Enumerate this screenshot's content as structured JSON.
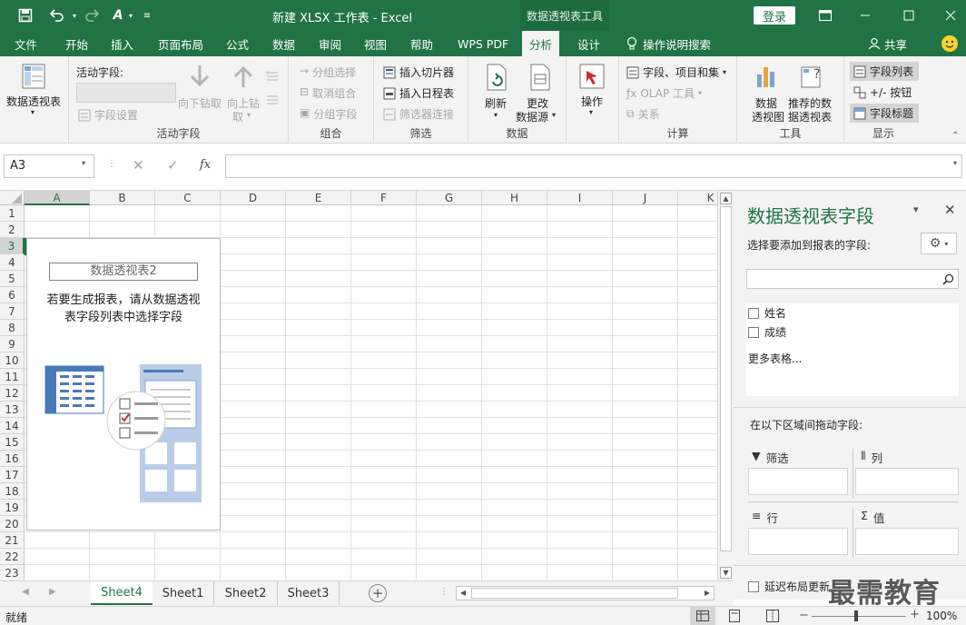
{
  "titlebar": {
    "title": "新建 XLSX 工作表  -  Excel",
    "context_tool": "数据透视表工具",
    "login": "登录"
  },
  "tabs": [
    {
      "label": "文件"
    },
    {
      "label": "开始"
    },
    {
      "label": "插入"
    },
    {
      "label": "页面布局"
    },
    {
      "label": "公式"
    },
    {
      "label": "数据"
    },
    {
      "label": "审阅"
    },
    {
      "label": "视图"
    },
    {
      "label": "帮助"
    },
    {
      "label": "WPS PDF"
    },
    {
      "label": "分析"
    },
    {
      "label": "设计"
    }
  ],
  "tell_me": "操作说明搜索",
  "share": "共享",
  "ribbon": {
    "pivot": {
      "label": "数据透视表"
    },
    "active_field": {
      "title": "活动字段:",
      "field_settings": "字段设置",
      "drill_down": "向下钻取",
      "drill_up": "向上钻",
      "drill_up2": "取",
      "group_label": "活动字段"
    },
    "group": {
      "group_select": "分组选择",
      "ungroup": "取消组合",
      "group_field": "分组字段",
      "group_label": "组合"
    },
    "filter": {
      "slicer": "插入切片器",
      "timeline": "插入日程表",
      "connections": "筛选器连接",
      "group_label": "筛选"
    },
    "data": {
      "refresh": "刷新",
      "change1": "更改",
      "change2": "数据源",
      "group_label": "数据"
    },
    "actions": {
      "label": "操作"
    },
    "calc": {
      "fields": "字段、项目和集",
      "olap": "OLAP 工具",
      "relations": "关系",
      "group_label": "计算"
    },
    "tools": {
      "chart1": "数据",
      "chart2": "透视图",
      "rec1": "推荐的数",
      "rec2": "据透视表",
      "group_label": "工具"
    },
    "show": {
      "field_list": "字段列表",
      "buttons": "+/- 按钮",
      "headers": "字段标题",
      "group_label": "显示"
    }
  },
  "formula_bar": {
    "name_box": "A3",
    "fx": "fx",
    "value": ""
  },
  "grid": {
    "columns": [
      "A",
      "B",
      "C",
      "D",
      "E",
      "F",
      "G",
      "H",
      "I",
      "J",
      "K"
    ],
    "rows": [
      "1",
      "2",
      "3",
      "4",
      "5",
      "6",
      "7",
      "8",
      "9",
      "10",
      "11",
      "12",
      "13",
      "14",
      "15",
      "16",
      "17",
      "18",
      "19",
      "20",
      "21",
      "22",
      "23"
    ]
  },
  "pivot_placeholder": {
    "name": "数据透视表2",
    "hint1": "若要生成报表，请从数据透视",
    "hint2": "表字段列表中选择字段"
  },
  "field_pane": {
    "title": "数据透视表字段",
    "choose": "选择要添加到报表的字段:",
    "search_placeholder": "",
    "fields": [
      {
        "name": "姓名"
      },
      {
        "name": "成绩"
      }
    ],
    "more_tables": "更多表格...",
    "drag_hint": "在以下区域间拖动字段:",
    "areas": {
      "filters": "筛选",
      "columns": "列",
      "rows": "行",
      "values": "值"
    },
    "defer": "延迟布局更新"
  },
  "sheets": [
    {
      "label": "Sheet4"
    },
    {
      "label": "Sheet1"
    },
    {
      "label": "Sheet2"
    },
    {
      "label": "Sheet3"
    }
  ],
  "status": {
    "ready": "就绪",
    "zoom": "100%"
  },
  "watermark": "最需教育",
  "colors": {
    "accent": "#217346",
    "ribbon_bg": "#f3f3f3"
  }
}
